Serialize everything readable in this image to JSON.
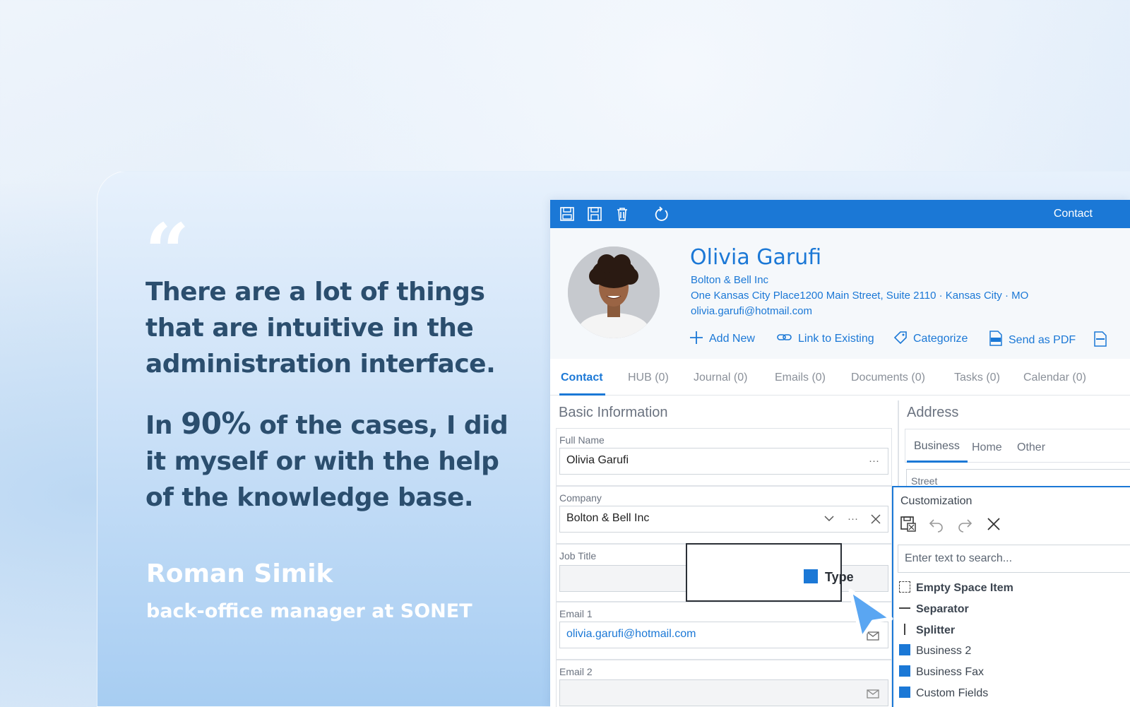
{
  "testimonial": {
    "quote_mark": "“",
    "paragraph1": "There are a lot of things that are intuitive in the administration interface.",
    "paragraph2_prefix": "In ",
    "paragraph2_highlight": "90%",
    "paragraph2_suffix": " of the cases, I did it myself or with the help of the knowledge base.",
    "author_name": "Roman Simik",
    "author_title": "back-office manager at SONET"
  },
  "app": {
    "window_title": "Contact",
    "toolbar_icons": [
      "save-close-icon",
      "save-icon",
      "delete-icon",
      "refresh-icon"
    ],
    "contact": {
      "name": "Olivia Garufi",
      "company": "Bolton & Bell Inc",
      "address": "One Kansas City Place1200 Main Street, Suite 2110 · Kansas City · MO",
      "email": "olivia.garufi@hotmail.com"
    },
    "actions": [
      {
        "label": "Add New",
        "icon": "plus-icon"
      },
      {
        "label": "Link to Existing",
        "icon": "link-icon"
      },
      {
        "label": "Categorize",
        "icon": "tag-icon"
      },
      {
        "label": "Send as PDF",
        "icon": "pdf-icon"
      }
    ],
    "tabs": [
      {
        "label": "Contact",
        "active": true
      },
      {
        "label": "HUB (0)"
      },
      {
        "label": "Journal (0)"
      },
      {
        "label": "Emails (0)"
      },
      {
        "label": "Documents (0)"
      },
      {
        "label": "Tasks (0)"
      },
      {
        "label": "Calendar (0)"
      }
    ],
    "basic_info": {
      "title": "Basic Information",
      "fields": [
        {
          "label": "Full Name",
          "value": "Olivia Garufi"
        },
        {
          "label": "Company",
          "value": "Bolton & Bell Inc"
        },
        {
          "label": "Job Title",
          "value": ""
        },
        {
          "label": "Email 1",
          "value": "olivia.garufi@hotmail.com"
        },
        {
          "label": "Email 2",
          "value": ""
        }
      ]
    },
    "address": {
      "title": "Address",
      "tabs": [
        "Business",
        "Home",
        "Other"
      ],
      "active_tab": "Business",
      "street_label": "Street"
    },
    "customization": {
      "title": "Customization",
      "search_placeholder": "Enter text to search...",
      "items": [
        {
          "label": "Empty Space Item",
          "kind": "empty"
        },
        {
          "label": "Separator",
          "kind": "separator"
        },
        {
          "label": "Splitter",
          "kind": "splitter"
        },
        {
          "label": "Business 2",
          "kind": "field"
        },
        {
          "label": "Business Fax",
          "kind": "field"
        },
        {
          "label": "Custom Fields",
          "kind": "field"
        }
      ]
    },
    "drag": {
      "label": "Type"
    },
    "colors": {
      "accent": "#1b78d6",
      "text_dark": "#2b4e6e"
    }
  }
}
